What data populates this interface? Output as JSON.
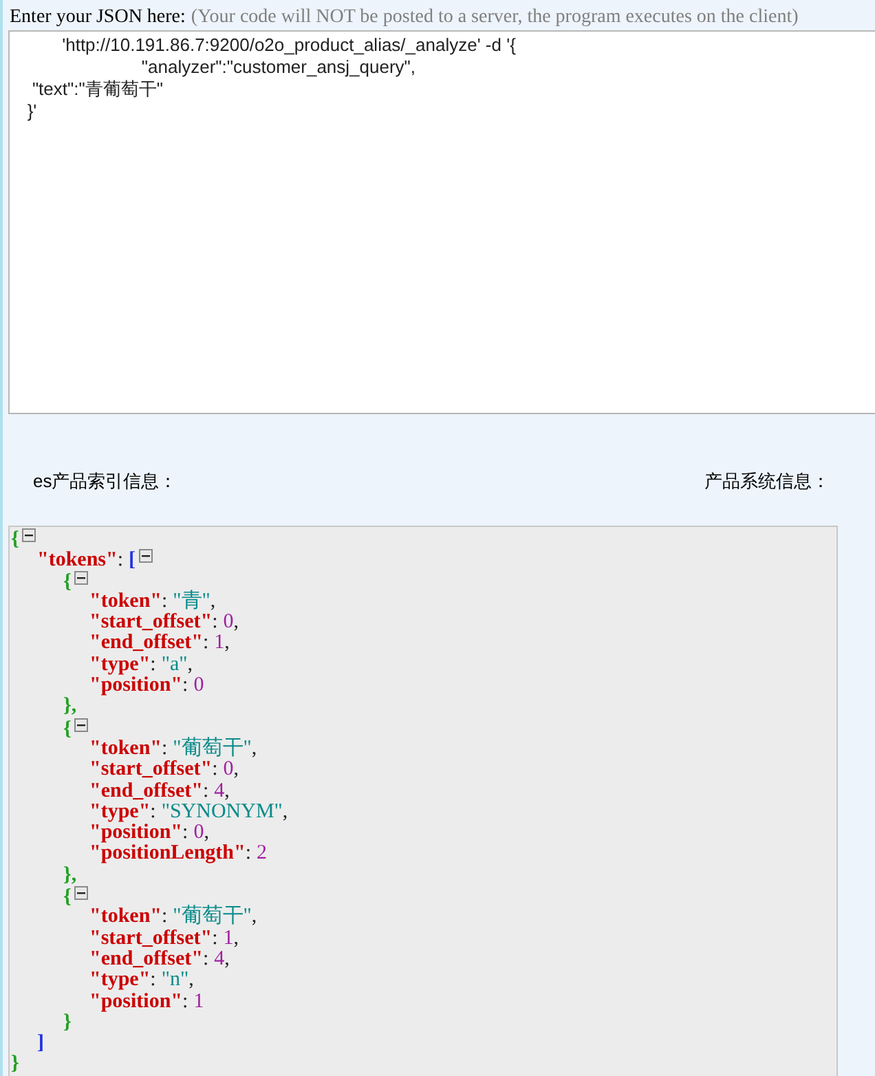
{
  "header": {
    "label": "Enter your JSON here:",
    "hint": "(Your code will NOT be posted to a server, the program executes on the client)"
  },
  "editor": {
    "lines": [
      "          'http://10.191.86.7:9200/o2o_product_alias/_analyze' -d '{",
      "                          \"analyzer\":\"customer_ansj_query\",",
      "    \"text\":\"青葡萄干\"",
      "   }'"
    ]
  },
  "labels": {
    "left": "es产品索引信息：",
    "right": "产品系统信息："
  },
  "viewer": {
    "open_brace": "{",
    "root_key": "\"tokens\"",
    "root_colon": ":",
    "open_bracket": "[",
    "close_bracket": "]",
    "close_brace": "}",
    "items": [
      {
        "open": "{",
        "close": "},",
        "fields": [
          {
            "key": "\"token\"",
            "colon": ":",
            "value": "\"青\"",
            "kind": "string",
            "comma": ","
          },
          {
            "key": "\"start_offset\"",
            "colon": ":",
            "value": "0",
            "kind": "number",
            "comma": ","
          },
          {
            "key": "\"end_offset\"",
            "colon": ":",
            "value": "1",
            "kind": "number",
            "comma": ","
          },
          {
            "key": "\"type\"",
            "colon": ":",
            "value": "\"a\"",
            "kind": "string",
            "comma": ","
          },
          {
            "key": "\"position\"",
            "colon": ":",
            "value": "0",
            "kind": "number"
          }
        ]
      },
      {
        "open": "{",
        "close": "},",
        "fields": [
          {
            "key": "\"token\"",
            "colon": ":",
            "value": "\"葡萄干\"",
            "kind": "string",
            "comma": ","
          },
          {
            "key": "\"start_offset\"",
            "colon": ":",
            "value": "0",
            "kind": "number",
            "comma": ","
          },
          {
            "key": "\"end_offset\"",
            "colon": ":",
            "value": "4",
            "kind": "number",
            "comma": ","
          },
          {
            "key": "\"type\"",
            "colon": ":",
            "value": "\"SYNONYM\"",
            "kind": "string",
            "comma": ","
          },
          {
            "key": "\"position\"",
            "colon": ":",
            "value": "0",
            "kind": "number",
            "comma": ","
          },
          {
            "key": "\"positionLength\"",
            "colon": ":",
            "value": "2",
            "kind": "number"
          }
        ]
      },
      {
        "open": "{",
        "close": "}",
        "fields": [
          {
            "key": "\"token\"",
            "colon": ":",
            "value": "\"葡萄干\"",
            "kind": "string",
            "comma": ","
          },
          {
            "key": "\"start_offset\"",
            "colon": ":",
            "value": "1",
            "kind": "number",
            "comma": ","
          },
          {
            "key": "\"end_offset\"",
            "colon": ":",
            "value": "4",
            "kind": "number",
            "comma": ","
          },
          {
            "key": "\"type\"",
            "colon": ":",
            "value": "\"n\"",
            "kind": "string",
            "comma": ","
          },
          {
            "key": "\"position\"",
            "colon": ":",
            "value": "1",
            "kind": "number"
          }
        ]
      }
    ]
  }
}
